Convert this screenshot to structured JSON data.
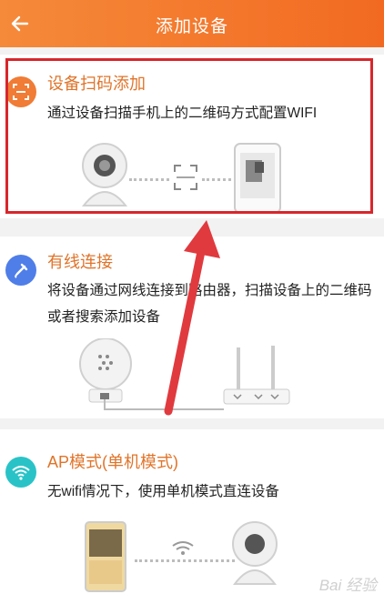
{
  "header": {
    "title": "添加设备",
    "back_icon": "arrow-left-icon"
  },
  "options": [
    {
      "title": "设备扫码添加",
      "desc": "通过设备扫描手机上的二维码方式配置WIFI",
      "icon": "scan-icon",
      "color": "#f07c35"
    },
    {
      "title": "有线连接",
      "desc": "将设备通过网线连接到路由器，扫描设备上的二维码或者搜索添加设备",
      "icon": "cable-icon",
      "color": "#4f7ee8"
    },
    {
      "title": "AP模式(单机模式)",
      "desc": "无wifi情况下，使用单机模式直连设备",
      "icon": "wifi-icon",
      "color": "#29c3c7"
    }
  ],
  "annotation": {
    "highlight_color": "#d8262b",
    "arrow_color": "#e03a3f"
  },
  "watermark": "Bai 经验"
}
